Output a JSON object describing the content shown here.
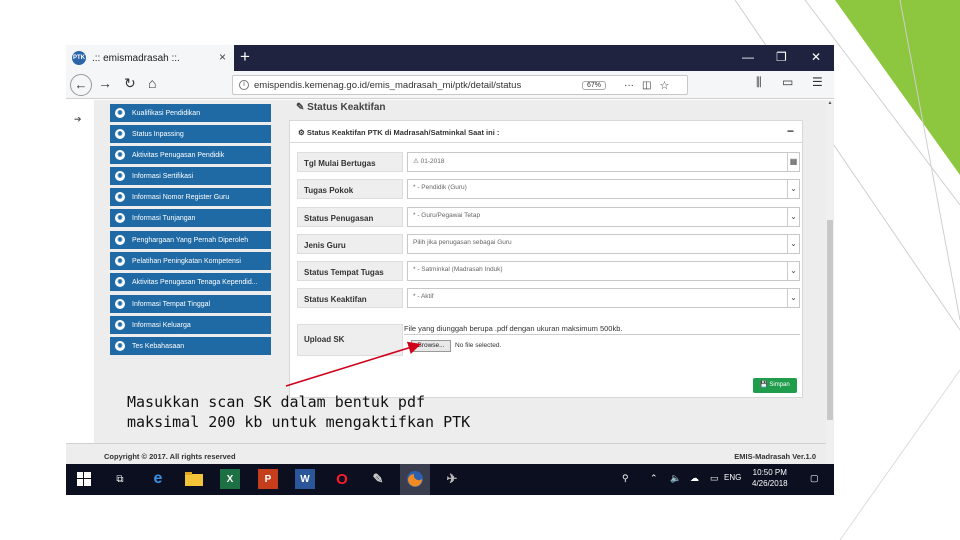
{
  "browser": {
    "tab_title": ".:: emismadrasah ::.",
    "favicon_text": "PTK",
    "new_tab": "+",
    "url": "emispendis.kemenag.go.id/emis_madrasah_mi/ptk/detail/status",
    "zoom": "67%",
    "window_min": "—",
    "window_restore": "❐",
    "window_close": "✕"
  },
  "sidebar": {
    "items": [
      {
        "label": "Kualifikasi Pendidikan"
      },
      {
        "label": "Status Inpassing"
      },
      {
        "label": "Aktivitas Penugasan Pendidik"
      },
      {
        "label": "Informasi Sertifikasi"
      },
      {
        "label": "Informasi Nomor Register Guru"
      },
      {
        "label": "Informasi Tunjangan"
      },
      {
        "label": "Penghargaan Yang Pernah Diperoleh"
      },
      {
        "label": "Pelatihan Peningkatan Kompetensi"
      },
      {
        "label": "Aktivitas Penugasan Tenaga Kependid..."
      },
      {
        "label": "Informasi Tempat Tinggal"
      },
      {
        "label": "Informasi Keluarga"
      },
      {
        "label": "Tes Kebahasaan"
      }
    ]
  },
  "main": {
    "section_title": "Status Keaktifan",
    "panel_title": "Status Keaktifan PTK di Madrasah/Satminkal Saat ini :",
    "fields": [
      {
        "label": "Tgl Mulai Bertugas",
        "value": "01-2018"
      },
      {
        "label": "Tugas Pokok",
        "value": "* - Pendidik (Guru)"
      },
      {
        "label": "Status Penugasan",
        "value": "* - Guru/Pegawai Tetap"
      },
      {
        "label": "Jenis Guru",
        "value": "Pilih jika penugasan sebagai Guru"
      },
      {
        "label": "Status Tempat Tugas",
        "value": "* - Satminkal (Madrasah Induk)"
      },
      {
        "label": "Status Keaktifan",
        "value": "* - Aktif"
      }
    ],
    "upload": {
      "label": "Upload SK",
      "hint": "File yang diunggah berupa .pdf dengan ukuran maksimum 500kb.",
      "browse": "Browse...",
      "no_file": "No file selected."
    },
    "save_button": "Simpan"
  },
  "footer": {
    "copyright": "Copyright © 2017. All rights reserved",
    "version": "EMIS-Madrasah Ver.1.0"
  },
  "taskbar": {
    "lang": "ENG",
    "time": "10:50 PM",
    "date": "4/26/2018"
  },
  "annotation": {
    "line1": "Masukkan scan SK dalam bentuk pdf",
    "line2": "maksimal 200 kb untuk mengaktifkan PTK"
  },
  "colors": {
    "accent_green": "#8dc63f",
    "menu_blue": "#1f6aa5",
    "save_green": "#1f9c4c",
    "arrow_red": "#d0021b"
  }
}
